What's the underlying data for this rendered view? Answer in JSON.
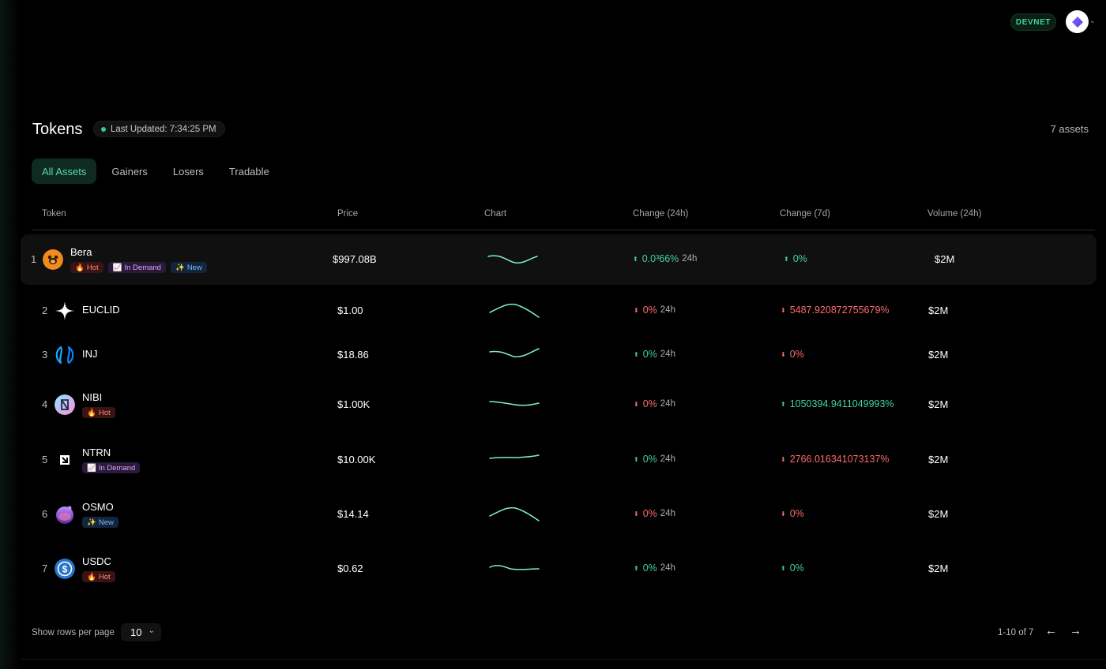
{
  "header": {
    "network": "DEVNET",
    "wallet_chevron": "⌄"
  },
  "page": {
    "title": "Tokens",
    "last_updated": "Last Updated: 7:34:25 PM",
    "asset_count": "7 assets"
  },
  "tabs": [
    "All Assets",
    "Gainers",
    "Losers",
    "Tradable"
  ],
  "columns": [
    "Token",
    "Price",
    "Chart",
    "Change (24h)",
    "Change (7d)",
    "Volume (24h)"
  ],
  "tokens": [
    {
      "rank": "1",
      "name": "Bera",
      "icon": "bera-bear-icon",
      "tags": [
        {
          "type": "hot",
          "label": "Hot",
          "icon": "🔥"
        },
        {
          "type": "demand",
          "label": "In Demand",
          "icon": "📈"
        },
        {
          "type": "new",
          "label": "New",
          "icon": "✨"
        }
      ],
      "price": "$997.08B",
      "chart": "wave-down-up",
      "change24h": {
        "dir": "up",
        "value": "0.0³66%",
        "suffix": "24h"
      },
      "change7d": {
        "dir": "up",
        "value": "0%"
      },
      "volume": "$2M"
    },
    {
      "rank": "2",
      "name": "EUCLID",
      "icon": "euclid-star-icon",
      "tags": [],
      "price": "$1.00",
      "chart": "hill",
      "change24h": {
        "dir": "down",
        "value": "0%",
        "suffix": "24h"
      },
      "change7d": {
        "dir": "down",
        "value": "5487.920872755679%"
      },
      "volume": "$2M"
    },
    {
      "rank": "3",
      "name": "INJ",
      "icon": "injective-icon",
      "tags": [],
      "price": "$18.86",
      "chart": "valley",
      "change24h": {
        "dir": "up",
        "value": "0%",
        "suffix": "24h"
      },
      "change7d": {
        "dir": "down",
        "value": "0%"
      },
      "volume": "$2M"
    },
    {
      "rank": "4",
      "name": "NIBI",
      "icon": "nibiru-icon",
      "tags": [
        {
          "type": "hot",
          "label": "Hot",
          "icon": "🔥"
        }
      ],
      "price": "$1.00K",
      "chart": "flat-dip",
      "change24h": {
        "dir": "down",
        "value": "0%",
        "suffix": "24h"
      },
      "change7d": {
        "dir": "up",
        "value": "1050394.9411049993%"
      },
      "volume": "$2M"
    },
    {
      "rank": "5",
      "name": "NTRN",
      "icon": "neutron-icon",
      "tags": [
        {
          "type": "demand",
          "label": "In Demand",
          "icon": "📈"
        }
      ],
      "price": "$10.00K",
      "chart": "flat-rise",
      "change24h": {
        "dir": "up",
        "value": "0%",
        "suffix": "24h"
      },
      "change7d": {
        "dir": "down",
        "value": "2766.016341073137%"
      },
      "volume": "$2M"
    },
    {
      "rank": "6",
      "name": "OSMO",
      "icon": "osmosis-icon",
      "tags": [
        {
          "type": "new",
          "label": "New",
          "icon": "✨"
        }
      ],
      "price": "$14.14",
      "chart": "hill",
      "change24h": {
        "dir": "down",
        "value": "0%",
        "suffix": "24h"
      },
      "change7d": {
        "dir": "down",
        "value": "0%"
      },
      "volume": "$2M"
    },
    {
      "rank": "7",
      "name": "USDC",
      "icon": "usdc-icon",
      "tags": [
        {
          "type": "hot",
          "label": "Hot",
          "icon": "🔥"
        }
      ],
      "price": "$0.62",
      "chart": "small-wave",
      "change24h": {
        "dir": "up",
        "value": "0%",
        "suffix": "24h"
      },
      "change7d": {
        "dir": "up",
        "value": "0%"
      },
      "volume": "$2M"
    }
  ],
  "pagination": {
    "rows_label": "Show rows per page",
    "rows_value": "10",
    "range": "1-10 of 7",
    "prev": "←",
    "next": "→"
  },
  "colors": {
    "up": "#3fd39a",
    "down": "#ff6b6b",
    "sparkline": "#7ff0c0",
    "accent": "#56d9a5"
  }
}
